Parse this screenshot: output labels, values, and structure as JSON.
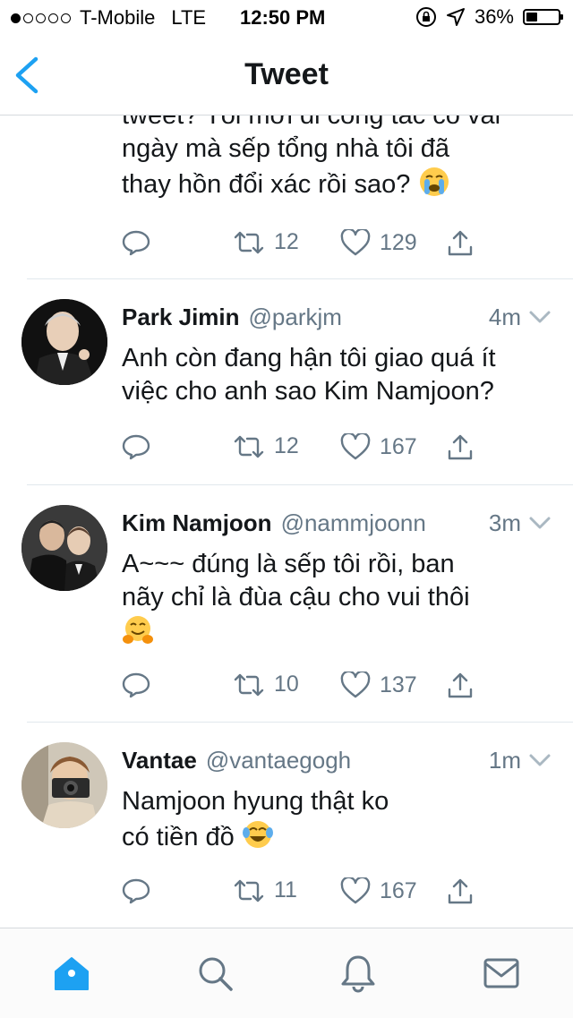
{
  "status": {
    "carrier": "T-Mobile",
    "network": "LTE",
    "time": "12:50 PM",
    "battery": "36%",
    "signal_bars_filled": 1,
    "signal_bars_total": 5
  },
  "nav": {
    "title": "Tweet"
  },
  "tweets": [
    {
      "text_line1": "tweet? Tôi mới đi công tác có vài",
      "text_line2": "ngày mà sếp tổng nhà tôi đã",
      "text_line3": "thay hồn đổi xác rồi sao?",
      "emoji": "crying-face",
      "retweets": "12",
      "likes": "129"
    },
    {
      "name": "Park Jimin",
      "handle": "@parkjm",
      "time": "4m",
      "text_line1": "Anh còn đang hận tôi giao quá ít",
      "text_line2": "việc cho anh sao Kim Namjoon?",
      "retweets": "12",
      "likes": "167"
    },
    {
      "name": "Kim Namjoon",
      "handle": "@nammjoonn",
      "time": "3m",
      "text_line1": "A~~~ đúng là sếp tôi rồi, ban",
      "text_line2": "nãy chỉ là đùa cậu cho vui thôi",
      "emoji": "hugging-face",
      "retweets": "10",
      "likes": "137"
    },
    {
      "name": "Vantae",
      "handle": "@vantaegogh",
      "time": "1m",
      "text_line1": "Namjoon hyung thật ko",
      "text_line2": "có tiền đồ",
      "emoji": "tears-of-joy-face",
      "retweets": "11",
      "likes": "167"
    }
  ],
  "tabs": [
    "home-icon",
    "search-icon",
    "notifications-icon",
    "messages-icon"
  ],
  "colors": {
    "accent": "#1da1f2",
    "text": "#14171a",
    "secondary": "#657786",
    "divider": "#e1e8ed"
  }
}
